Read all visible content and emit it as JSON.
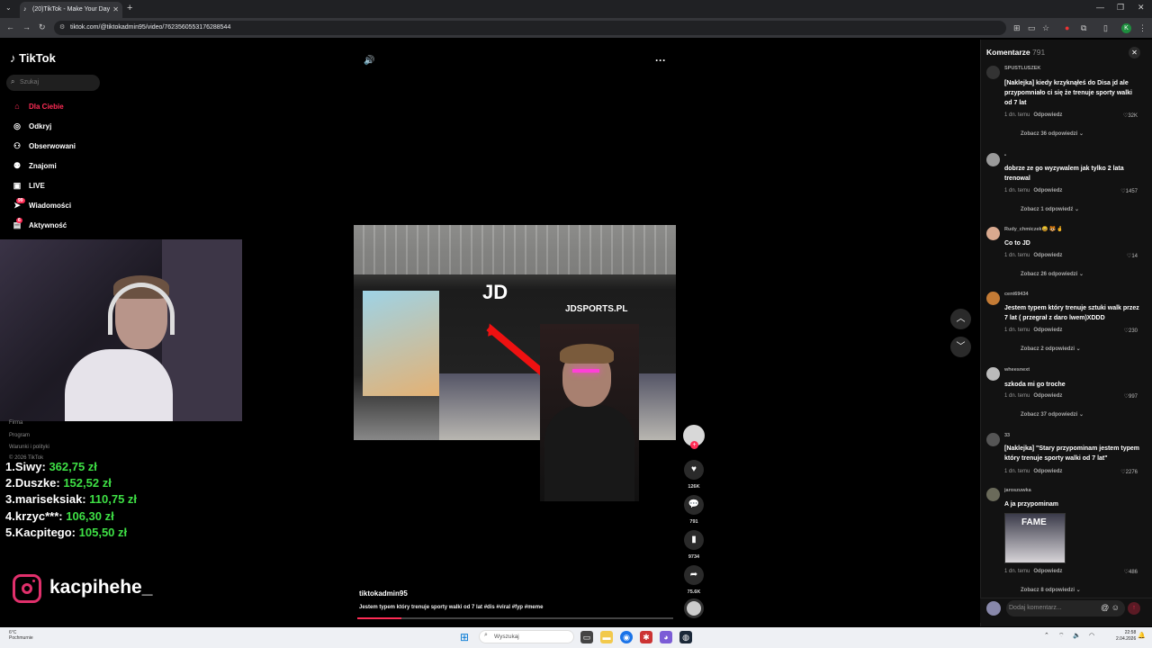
{
  "browser": {
    "tab_title": "(20)TikTok - Make Your Day",
    "url": "tiktok.com/@tiktokadmin95/video/7623560553176288544",
    "profile_initial": "K"
  },
  "sidebar": {
    "logo": "TikTok",
    "search_placeholder": "Szukaj",
    "items": [
      {
        "label": "Dla Ciebie",
        "icon": "home-icon"
      },
      {
        "label": "Odkryj",
        "icon": "compass-icon"
      },
      {
        "label": "Obserwowani",
        "icon": "following-icon"
      },
      {
        "label": "Znajomi",
        "icon": "friends-icon"
      },
      {
        "label": "LIVE",
        "icon": "live-icon"
      },
      {
        "label": "Wiadomości",
        "icon": "messages-icon",
        "badge": "99"
      },
      {
        "label": "Aktywność",
        "icon": "activity-icon",
        "badge": "6"
      }
    ],
    "footer": [
      "Firma",
      "Program",
      "Warunki i polityki",
      "© 2026 TikTok"
    ]
  },
  "leaderboard": [
    {
      "rank": "1.",
      "name": "Siwy:",
      "amount": "362,75 zł"
    },
    {
      "rank": "2.",
      "name": "Duszke:",
      "amount": "152,52 zł"
    },
    {
      "rank": "3.",
      "name": "mariseksiak:",
      "amount": "110,75 zł"
    },
    {
      "rank": "4.",
      "name": "krzyc***:",
      "amount": "106,30 zł"
    },
    {
      "rank": "5.",
      "name": "Kacpitego:",
      "amount": "105,50 zł"
    }
  ],
  "instagram_handle": "kacpihehe_",
  "video": {
    "store_sign": "JD",
    "store_sign_2": "JDSPORTS.PL",
    "author": "tiktokadmin95",
    "caption": "Jestem typem który trenuje sporty walki od 7 lat #dis #viral #fyp #meme",
    "progress": 0.14,
    "likes": "126K",
    "comments": "791",
    "saves": "9734",
    "shares": "75.6K"
  },
  "comments_panel": {
    "title": "Komentarze",
    "count": "791",
    "input_placeholder": "Dodaj komentarz...",
    "comments": [
      {
        "user": "SPUSTLUSZEK",
        "text": "[Naklejka] kiedy krzyknąłeś do Disa jd ale przypomniało ci się że trenuje sporty walki od 7 lat",
        "time": "1 dn. temu",
        "reply": "Odpowiedz",
        "likes": "32K",
        "replies": "Zobacz 36 odpowiedzi"
      },
      {
        "user": "•",
        "text": "dobrze ze go wyzywalem jak tylko 2 lata trenowal",
        "time": "1 dn. temu",
        "reply": "Odpowiedz",
        "likes": "1457",
        "replies": "Zobacz 1 odpowiedź"
      },
      {
        "user": "Rudy_chmiczek😄 🐯 🤞",
        "text": "Co to JD",
        "time": "1 dn. temu",
        "reply": "Odpowiedz",
        "likes": "14",
        "replies": "Zobacz 26 odpowiedzi"
      },
      {
        "user": "cent69434",
        "text": "Jestem typem który trenuje sztuki walk przez 7 lat ( przegrał z daro lwem)XDDD",
        "time": "1 dn. temu",
        "reply": "Odpowiedz",
        "likes": "230",
        "replies": "Zobacz 2 odpowiedzi"
      },
      {
        "user": "wheesnext",
        "text": "szkoda mi go troche",
        "time": "1 dn. temu",
        "reply": "Odpowiedz",
        "likes": "997",
        "replies": "Zobacz 37 odpowiedzi"
      },
      {
        "user": "33",
        "text": "[Naklejka] \"Stary przypominam jestem typem który trenuje sporty walki od 7 lat\"",
        "time": "1 dn. temu",
        "reply": "Odpowiedz",
        "likes": "2276",
        "replies": ""
      },
      {
        "user": "jaroszuwka",
        "text": "A ja przypominam",
        "time": "1 dn. temu",
        "reply": "Odpowiedz",
        "likes": "486",
        "replies": "Zobacz 8 odpowiedzi",
        "thumb_text": "FAME"
      }
    ]
  },
  "taskbar": {
    "weather_temp": "6°C",
    "weather_desc": "Pochmurnie",
    "search_placeholder": "Wyszukaj",
    "time": "22:58",
    "date": "2.04.2026"
  },
  "colors": {
    "accent": "#fe2c55",
    "money": "#3ee045"
  }
}
